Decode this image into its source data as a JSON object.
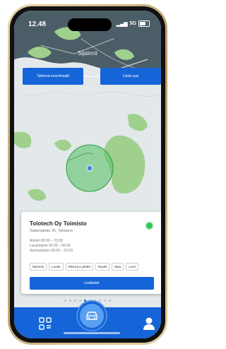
{
  "status_bar": {
    "time": "12.48",
    "network": "5G"
  },
  "header": {
    "title": "Sijainnit"
  },
  "top_buttons": {
    "save_coords": "Tallenna koordinaatit",
    "add_new": "Lisää uusi"
  },
  "location_card": {
    "name": "Tolotech Oy Toimisto",
    "address": "Satamakatu 26, Tampere",
    "hours": [
      "Arkisin 00.00 – 23.59",
      "Lauantaisin 00.00 – 00.00",
      "Sunnuntaisin 00.00 – 23.59"
    ],
    "tags": [
      "Moreeni",
      "Louhe",
      "Riisut ja Lahdet",
      "Deyeli",
      "Maa",
      "Lumi"
    ],
    "cta": "Lisätiedot"
  },
  "pager": {
    "count": 10,
    "active_index": 4
  },
  "map_legal": "©",
  "colors": {
    "primary": "#1565d8",
    "status_green": "#34c759",
    "accent_light": "#5aa0f0"
  },
  "tab_bar": {
    "icons": [
      "qr-icon",
      "car-icon",
      "user-icon"
    ],
    "active": "car-icon"
  }
}
